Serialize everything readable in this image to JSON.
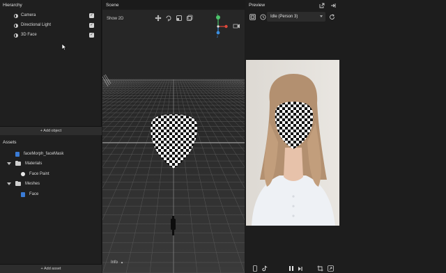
{
  "hierarchy": {
    "title": "Hierarchy",
    "items": [
      {
        "label": "Camera"
      },
      {
        "label": "Directional Light"
      },
      {
        "label": "3D Face"
      }
    ],
    "check_glyph": "✓",
    "add_object_label": "+ Add object"
  },
  "assets": {
    "title": "Assets",
    "items": [
      {
        "label": "faceMorph_faceMask"
      },
      {
        "label": "Materials"
      },
      {
        "label": "Face Paint"
      },
      {
        "label": "Meshes"
      },
      {
        "label": "Face"
      }
    ],
    "add_asset_label": "+ Add asset"
  },
  "scene": {
    "title": "Scene",
    "show2d_label": "Show 2D",
    "info_label": "Info",
    "info_caret": "▴",
    "gizmo_y": "y",
    "gizmo_z": "z",
    "tools": [
      "move-tool-icon",
      "rotate-tool-icon",
      "scale-tool-icon",
      "rect-tool-icon"
    ]
  },
  "preview": {
    "title": "Preview",
    "selected_preview": "Idle (Person 3)"
  },
  "colors": {
    "accent_blue": "#3a7bd5",
    "gizmo_green": "#4cc36b",
    "gizmo_red": "#e0473a",
    "gizmo_blue": "#3b8fe0",
    "panel_bg": "#1f1f1f",
    "scene_bg": "#262626"
  }
}
